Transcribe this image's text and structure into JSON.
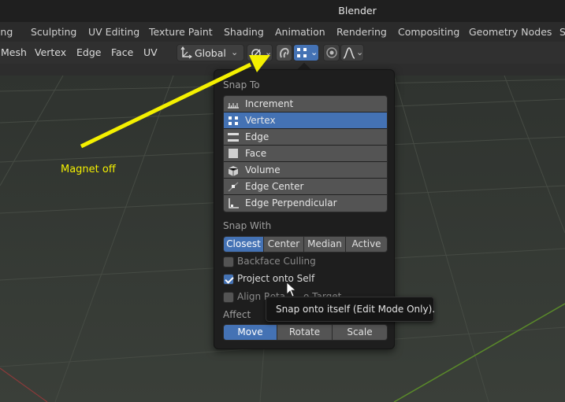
{
  "app": {
    "title": "Blender"
  },
  "workspace_tabs": [
    "lling",
    "Sculpting",
    "UV Editing",
    "Texture Paint",
    "Shading",
    "Animation",
    "Rendering",
    "Compositing",
    "Geometry Nodes",
    "S"
  ],
  "header": {
    "menus": [
      "Mesh",
      "Vertex",
      "Edge",
      "Face",
      "UV"
    ],
    "orientation": "Global"
  },
  "popup": {
    "snap_to_label": "Snap To",
    "snap_to_items": [
      {
        "label": "Increment",
        "icon": "increment-icon"
      },
      {
        "label": "Vertex",
        "icon": "vertex-icon"
      },
      {
        "label": "Edge",
        "icon": "edge-icon"
      },
      {
        "label": "Face",
        "icon": "face-icon"
      },
      {
        "label": "Volume",
        "icon": "volume-icon"
      },
      {
        "label": "Edge Center",
        "icon": "edge-center-icon"
      },
      {
        "label": "Edge Perpendicular",
        "icon": "edge-perpendicular-icon"
      }
    ],
    "snap_to_selected": "Vertex",
    "snap_with_label": "Snap With",
    "snap_with_options": [
      "Closest",
      "Center",
      "Median",
      "Active"
    ],
    "snap_with_selected": "Closest",
    "backface_culling": {
      "label": "Backface Culling",
      "checked": false
    },
    "project_onto_self": {
      "label": "Project onto Self",
      "checked": true
    },
    "align_rotation": {
      "label": "Align Rotation to Target",
      "checked": false,
      "visible_text": "Align Rota"
    },
    "align_rotation_tail": "o Target",
    "affect_label": "Affect",
    "affect_options": [
      "Move",
      "Rotate",
      "Scale"
    ],
    "affect_selected": "Move"
  },
  "tooltip": {
    "text": "Snap onto itself (Edit Mode Only)."
  },
  "annotation": {
    "text": "Magnet off",
    "color": "#f4f000"
  },
  "colors": {
    "accent": "#4472b4",
    "panel": "#1e1e1e",
    "item": "#545454"
  }
}
